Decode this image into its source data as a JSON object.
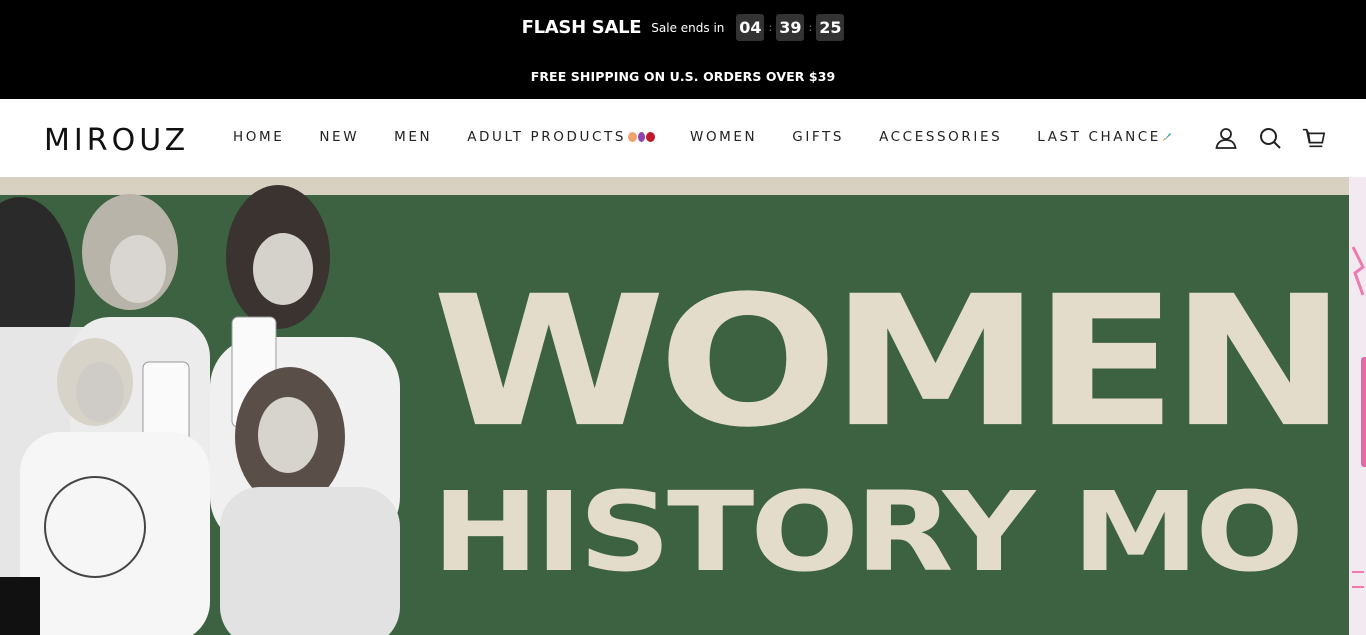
{
  "promo": {
    "flash_title": "FLASH SALE",
    "flash_sub": "Sale ends in",
    "countdown": {
      "hours": "04",
      "minutes": "39",
      "seconds": "25",
      "separator": ":"
    },
    "shipping": "FREE SHIPPING ON U.S. ORDERS OVER $39"
  },
  "header": {
    "logo": "MIROUZ",
    "nav": [
      {
        "label": "HOME"
      },
      {
        "label": "NEW"
      },
      {
        "label": "MEN"
      },
      {
        "label": "ADULT PRODUCTS"
      },
      {
        "label": "WOMEN"
      },
      {
        "label": "GIFTS"
      },
      {
        "label": "ACCESSORIES"
      },
      {
        "label": "LAST CHANCE"
      }
    ],
    "icons": [
      "account-icon",
      "search-icon",
      "cart-icon"
    ]
  },
  "hero": {
    "line1": "WOMEN",
    "line2": "HISTORY MO",
    "colors": {
      "background": "#3c6241",
      "text": "#e3dccb",
      "band": "#d8d0c1"
    }
  }
}
